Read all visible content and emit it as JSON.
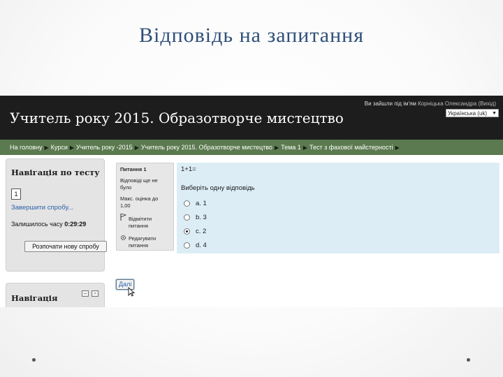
{
  "slide": {
    "title": "Відповідь на запитання"
  },
  "header": {
    "site_title": "Учитель року 2015. Образотворче мистецтво",
    "login_prefix": "Ви зайшли під ім'ям",
    "login_user": "Корніцька Олександра",
    "login_logout": "(Вихід)",
    "language": "Українська (uk)"
  },
  "breadcrumb": {
    "items": [
      "На головну",
      "Курси",
      "Учитель року -2015",
      "Учитель року 2015. Образотворче мистецтво",
      "Тема 1",
      "Тест з фахової майстерності"
    ]
  },
  "quiz_nav": {
    "heading": "Навігація по тесту",
    "question_number": "1",
    "finish_link": "Завершити спробу...",
    "time_label": "Залишилось часу",
    "time_value": "0:29:29",
    "restart_button": "Розпочати нову спробу"
  },
  "nav_block": {
    "heading": "Навігація"
  },
  "question_info": {
    "title": "Питання 1",
    "state": "Відповіді ще не було",
    "grade": "Макс. оцінка до 1,00",
    "flag_label": "Відмітити питання",
    "edit_label": "Редагувати питання"
  },
  "question": {
    "text": "1+1=",
    "prompt": "Виберіть одну відповідь",
    "answers": [
      {
        "label": "a. 1",
        "selected": false
      },
      {
        "label": "b. 3",
        "selected": false
      },
      {
        "label": "c. 2",
        "selected": true
      },
      {
        "label": "d. 4",
        "selected": false
      }
    ]
  },
  "next_button": "Далі",
  "colors": {
    "header_bg": "#1d1d1d",
    "navbar_bg": "#5b7a4f",
    "question_bg": "#dcedf6",
    "block_bg": "#e4e4e4",
    "title_color": "#2f4f7a"
  }
}
